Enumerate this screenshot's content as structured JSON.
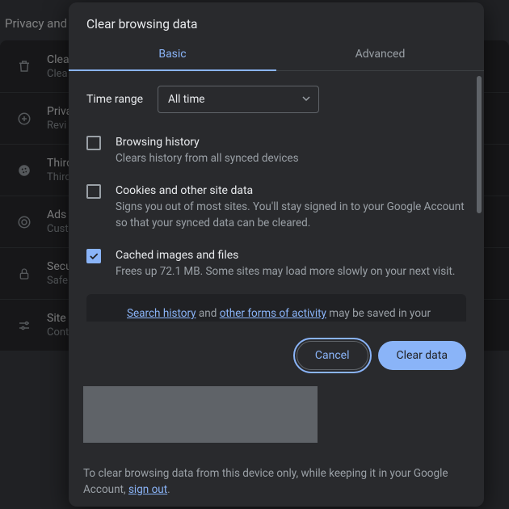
{
  "bg": {
    "section_title": "Privacy and s",
    "rows": [
      {
        "icon": "trash-icon",
        "t1": "Clea",
        "t2": "Clea"
      },
      {
        "icon": "plus-circle-icon",
        "t1": "Priva",
        "t2": "Revi"
      },
      {
        "icon": "cookie-icon",
        "t1": "Third",
        "t2": "Third"
      },
      {
        "icon": "target-icon",
        "t1": "Ads",
        "t2": "Cust"
      },
      {
        "icon": "lock-icon",
        "t1": "Secu",
        "t2": "Safe"
      },
      {
        "icon": "sliders-icon",
        "t1": "Site s",
        "t2": "Cont"
      }
    ]
  },
  "modal": {
    "title": "Clear browsing data",
    "tabs": {
      "basic": "Basic",
      "advanced": "Advanced",
      "active": "basic"
    },
    "time_range": {
      "label": "Time range",
      "value": "All time"
    },
    "options": [
      {
        "key": "history",
        "checked": false,
        "title": "Browsing history",
        "desc": "Clears history from all synced devices"
      },
      {
        "key": "cookies",
        "checked": false,
        "title": "Cookies and other site data",
        "desc": "Signs you out of most sites. You'll stay signed in to your Google Account so that your synced data can be cleared."
      },
      {
        "key": "cache",
        "checked": true,
        "title": "Cached images and files",
        "desc": "Frees up 72.1 MB. Some sites may load more slowly on your next visit."
      }
    ],
    "info": {
      "link1": "Search history",
      "mid1": " and ",
      "link2": "other forms of activity",
      "rest": " may be saved in your Google Account when you're signed in. You can delete them at any"
    },
    "actions": {
      "cancel": "Cancel",
      "clear": "Clear data"
    },
    "footer": {
      "pre": "To clear browsing data from this device only, while keeping it in your Google Account, ",
      "link": "sign out",
      "post": "."
    }
  }
}
